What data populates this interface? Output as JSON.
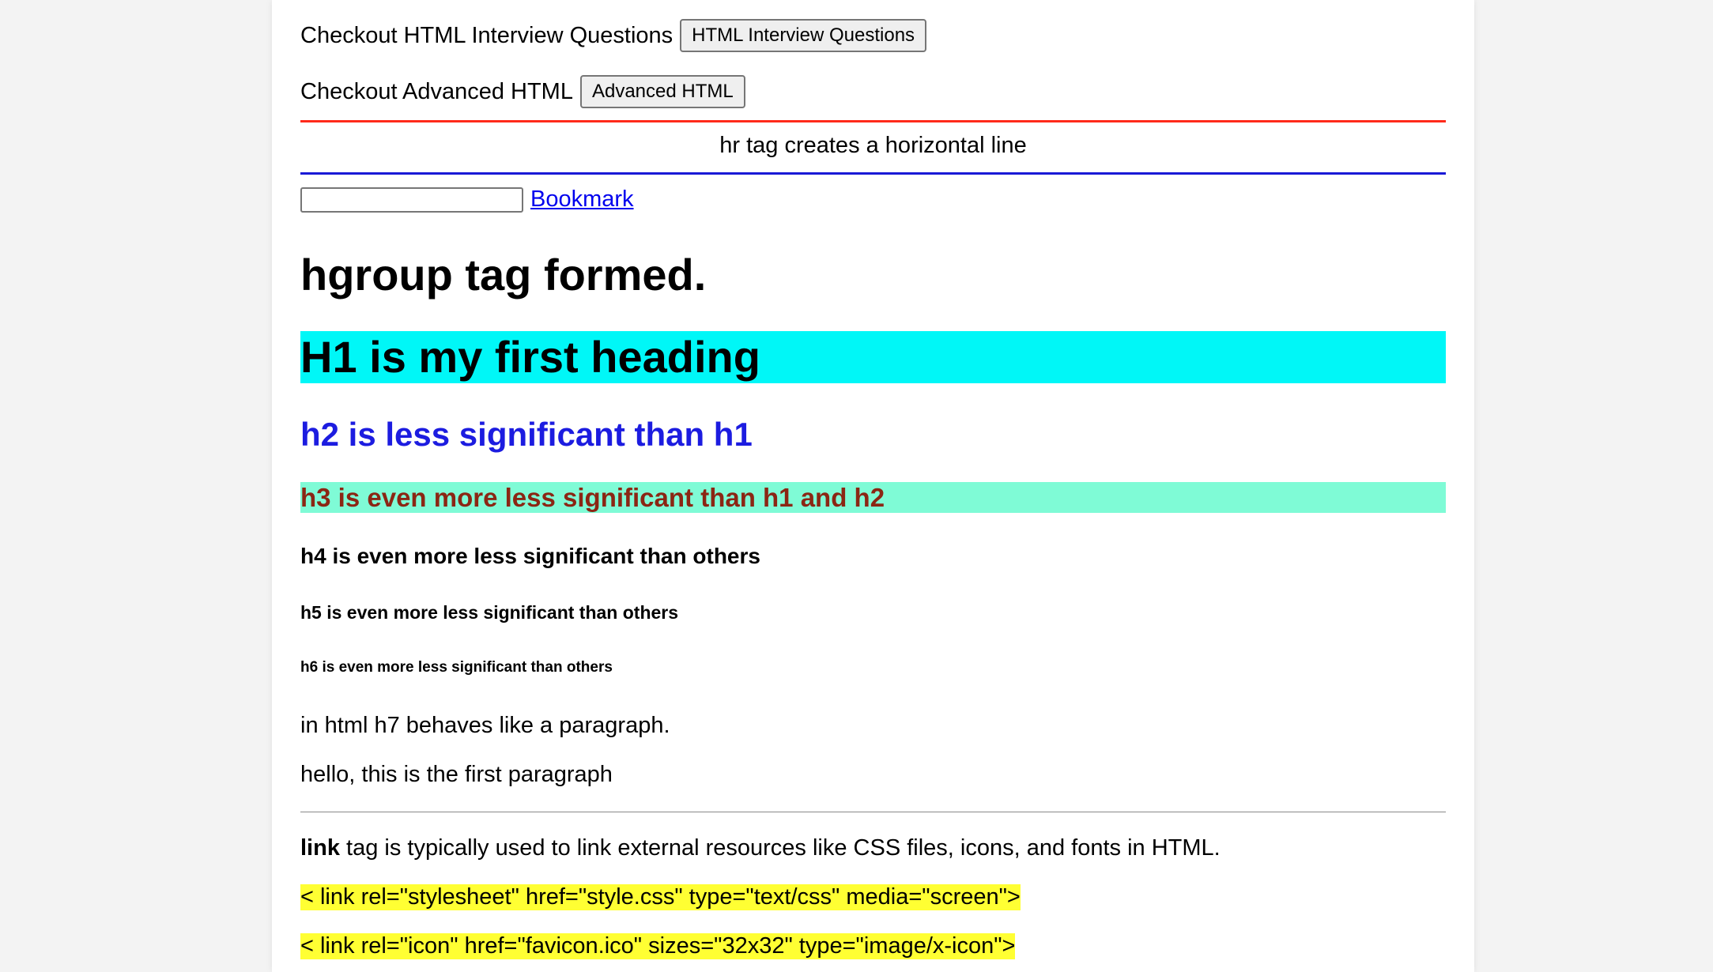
{
  "rows": {
    "interview": {
      "label": "Checkout HTML Interview Questions",
      "button": "HTML Interview Questions"
    },
    "advanced": {
      "label": "Checkout Advanced HTML",
      "button": "Advanced HTML"
    }
  },
  "hr_text": "hr tag creates a horizontal line",
  "bookmark": {
    "input_value": "",
    "link_text": "Bookmark"
  },
  "headings": {
    "hgroup": "hgroup tag formed.",
    "h1": "H1 is my first heading",
    "h2": "h2 is less significant than h1",
    "h3": "h3 is even more less significant than h1 and h2",
    "h4": "h4 is even more less significant than others",
    "h5": "h5 is even more less significant than others",
    "h6": "h6 is even more less significant than others"
  },
  "paragraphs": {
    "h7": "in html h7 behaves like a paragraph.",
    "first": "hello, this is the first paragraph"
  },
  "link_info": {
    "bold": "link",
    "rest": " tag is typically used to link external resources like CSS files, icons, and fonts in HTML.",
    "code1": "< link rel=\"stylesheet\" href=\"style.css\" type=\"text/css\" media=\"screen\">",
    "code2": "< link rel=\"icon\" href=\"favicon.ico\" sizes=\"32x32\" type=\"image/x-icon\">"
  },
  "colors": {
    "hr_top": "#ff2a1a",
    "hr_bottom": "#1a1ad6",
    "h1_bg": "#00f7f7",
    "h2_text": "#1c1ce0",
    "h3_bg": "#7ffbd6",
    "h3_text": "#8b2614",
    "code_bg": "#ffff33",
    "link": "#0000ee"
  }
}
